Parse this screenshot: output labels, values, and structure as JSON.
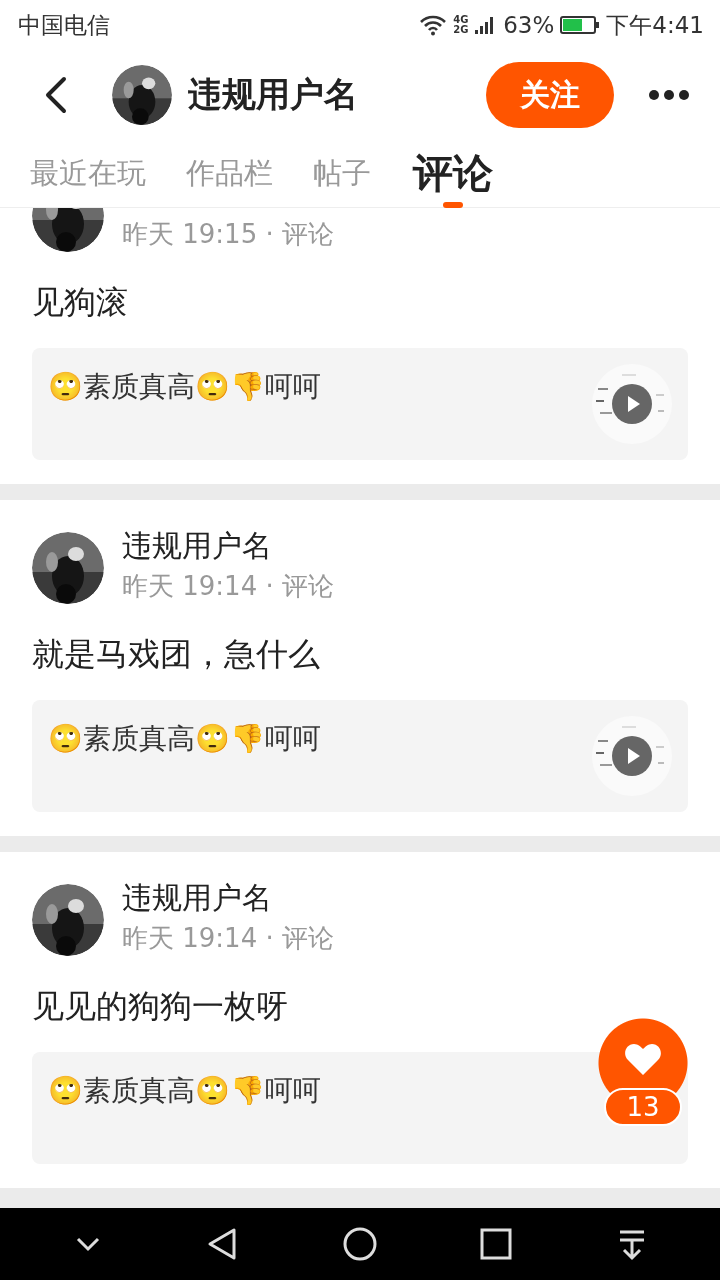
{
  "status_bar": {
    "carrier": "中国电信",
    "network": "4G 2G",
    "battery": "63%",
    "time": "下午4:41"
  },
  "header": {
    "title": "违规用户名",
    "follow_button": "关注"
  },
  "tabs": [
    {
      "label": "最近在玩",
      "selected": false
    },
    {
      "label": "作品栏",
      "selected": false
    },
    {
      "label": "帖子",
      "selected": false
    },
    {
      "label": "评论",
      "selected": true
    }
  ],
  "comments": [
    {
      "meta": "昨天 19:15 · 评论",
      "text": "见狗滚",
      "quote": "🙄素质真高🙄👎呵呵"
    },
    {
      "author": "违规用户名",
      "meta": "昨天 19:14 · 评论",
      "text": "就是马戏团，急什么",
      "quote": "🙄素质真高🙄👎呵呵"
    },
    {
      "author": "违规用户名",
      "meta": "昨天 19:14 · 评论",
      "text": "见见的狗狗一枚呀",
      "quote": "🙄素质真高🙄👎呵呵",
      "video_hidden": true
    }
  ],
  "like": {
    "count": "13"
  }
}
